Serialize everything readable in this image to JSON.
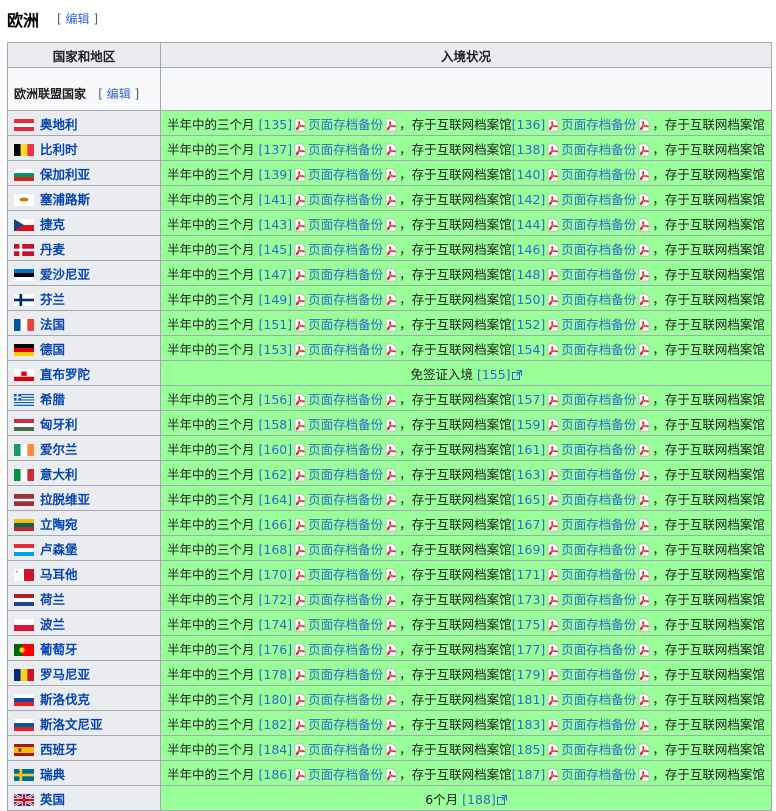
{
  "section": {
    "title": "欧洲",
    "edit_label": "编辑"
  },
  "table": {
    "col_country": "国家和地区",
    "col_status": "入境状况",
    "subheading": "欧洲联盟国家",
    "subheading_edit": "编辑",
    "status_text": "半年中的三个月",
    "archive_text": "页面存档备份",
    "comma": "，",
    "internet_archive_text": "存于互联网档案馆"
  },
  "flags": {
    "奥地利": [
      "stripes-h",
      "#ed2939",
      "#ffffff",
      "#ed2939"
    ],
    "比利时": [
      "stripes-v",
      "#000000",
      "#fdda24",
      "#ef3340"
    ],
    "保加利亚": [
      "stripes-h",
      "#ffffff",
      "#00966e",
      "#d62612"
    ],
    "塞浦路斯": [
      "cyprus",
      "#ffffff",
      "#d57800"
    ],
    "捷克": [
      "czech",
      "#ffffff",
      "#d7141a",
      "#11457e"
    ],
    "丹麦": [
      "nordic",
      "#c8102e",
      "#ffffff"
    ],
    "爱沙尼亚": [
      "stripes-h",
      "#0072ce",
      "#000000",
      "#ffffff"
    ],
    "芬兰": [
      "nordic",
      "#ffffff",
      "#002f6c"
    ],
    "法国": [
      "stripes-v",
      "#0055a4",
      "#ffffff",
      "#ef4135"
    ],
    "德国": [
      "stripes-h",
      "#000000",
      "#dd0000",
      "#ffce00"
    ],
    "直布罗陀": [
      "gib",
      "#ffffff",
      "#da000c"
    ],
    "希腊": [
      "greece",
      "#0d5eaf",
      "#ffffff"
    ],
    "匈牙利": [
      "stripes-h",
      "#cd2a3e",
      "#ffffff",
      "#436f4d"
    ],
    "爱尔兰": [
      "stripes-v",
      "#169b62",
      "#ffffff",
      "#ff883e"
    ],
    "意大利": [
      "stripes-v",
      "#009246",
      "#ffffff",
      "#ce2b37"
    ],
    "拉脱维亚": [
      "latvia",
      "#9e3039",
      "#ffffff"
    ],
    "立陶宛": [
      "stripes-h",
      "#fdb913",
      "#006a44",
      "#c1272d"
    ],
    "卢森堡": [
      "stripes-h",
      "#ed2939",
      "#ffffff",
      "#00a1de"
    ],
    "马耳他": [
      "stripes-v2",
      "#ffffff",
      "#cf142b"
    ],
    "荷兰": [
      "stripes-h",
      "#ae1c28",
      "#ffffff",
      "#21468b"
    ],
    "波兰": [
      "stripes-h2",
      "#ffffff",
      "#dc143c"
    ],
    "葡萄牙": [
      "portugal",
      "#006600",
      "#ff0000",
      "#ffcc00"
    ],
    "罗马尼亚": [
      "stripes-v",
      "#002b7f",
      "#fcd116",
      "#ce1126"
    ],
    "斯洛伐克": [
      "stripes-h",
      "#ffffff",
      "#0b4ea2",
      "#ee1c25"
    ],
    "斯洛文尼亚": [
      "stripes-h",
      "#ffffff",
      "#005da4",
      "#ed1c24"
    ],
    "西班牙": [
      "spain",
      "#aa151b",
      "#f1bf00"
    ],
    "瑞典": [
      "nordic",
      "#006aa7",
      "#fecc00"
    ],
    "英国": [
      "uk",
      "#012169",
      "#ffffff",
      "#c8102e"
    ]
  },
  "rows": [
    {
      "country": "奥地利",
      "refs": [
        "[135]",
        "[136]"
      ]
    },
    {
      "country": "比利时",
      "refs": [
        "[137]",
        "[138]"
      ]
    },
    {
      "country": "保加利亚",
      "refs": [
        "[139]",
        "[140]"
      ]
    },
    {
      "country": "塞浦路斯",
      "refs": [
        "[141]",
        "[142]"
      ]
    },
    {
      "country": "捷克",
      "refs": [
        "[143]",
        "[144]"
      ]
    },
    {
      "country": "丹麦",
      "refs": [
        "[145]",
        "[146]"
      ]
    },
    {
      "country": "爱沙尼亚",
      "refs": [
        "[147]",
        "[148]"
      ]
    },
    {
      "country": "芬兰",
      "refs": [
        "[149]",
        "[150]"
      ]
    },
    {
      "country": "法国",
      "refs": [
        "[151]",
        "[152]"
      ]
    },
    {
      "country": "德国",
      "refs": [
        "[153]",
        "[154]"
      ]
    },
    {
      "country": "直布罗陀",
      "special": "免签证入境",
      "ref": "[155]"
    },
    {
      "country": "希腊",
      "refs": [
        "[156]",
        "[157]"
      ]
    },
    {
      "country": "匈牙利",
      "refs": [
        "[158]",
        "[159]"
      ]
    },
    {
      "country": "爱尔兰",
      "refs": [
        "[160]",
        "[161]"
      ]
    },
    {
      "country": "意大利",
      "refs": [
        "[162]",
        "[163]"
      ]
    },
    {
      "country": "拉脱维亚",
      "refs": [
        "[164]",
        "[165]"
      ]
    },
    {
      "country": "立陶宛",
      "refs": [
        "[166]",
        "[167]"
      ]
    },
    {
      "country": "卢森堡",
      "refs": [
        "[168]",
        "[169]"
      ]
    },
    {
      "country": "马耳他",
      "refs": [
        "[170]",
        "[171]"
      ]
    },
    {
      "country": "荷兰",
      "refs": [
        "[172]",
        "[173]"
      ]
    },
    {
      "country": "波兰",
      "refs": [
        "[174]",
        "[175]"
      ]
    },
    {
      "country": "葡萄牙",
      "refs": [
        "[176]",
        "[177]"
      ]
    },
    {
      "country": "罗马尼亚",
      "refs": [
        "[178]",
        "[179]"
      ]
    },
    {
      "country": "斯洛伐克",
      "refs": [
        "[180]",
        "[181]"
      ]
    },
    {
      "country": "斯洛文尼亚",
      "refs": [
        "[182]",
        "[183]"
      ]
    },
    {
      "country": "西班牙",
      "refs": [
        "[184]",
        "[185]"
      ]
    },
    {
      "country": "瑞典",
      "refs": [
        "[186]",
        "[187]"
      ]
    },
    {
      "country": "英国",
      "special": "6个月",
      "ref": "[188]"
    }
  ]
}
